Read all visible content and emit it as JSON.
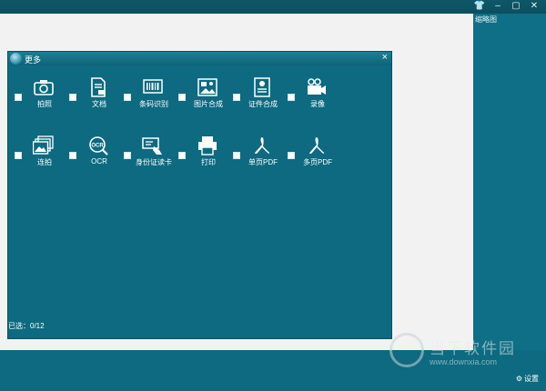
{
  "window": {
    "controls": {
      "skin": "👕",
      "minimize": "–",
      "maximize": "▢",
      "close": "✕"
    }
  },
  "right_panel": {
    "title": "缩略图"
  },
  "dialog": {
    "title": "更多",
    "close": "×",
    "selected_label": "已选：0/12",
    "tools": [
      {
        "label": "拍照",
        "icon": "camera-icon"
      },
      {
        "label": "文档",
        "icon": "document-icon"
      },
      {
        "label": "条码识别",
        "icon": "barcode-icon"
      },
      {
        "label": "图片合成",
        "icon": "image-merge-icon"
      },
      {
        "label": "证件合成",
        "icon": "id-merge-icon"
      },
      {
        "label": "录像",
        "icon": "video-icon"
      },
      {
        "label": "连拍",
        "icon": "burst-icon"
      },
      {
        "label": "OCR",
        "icon": "ocr-icon"
      },
      {
        "label": "身份证读卡",
        "icon": "id-card-reader-icon"
      },
      {
        "label": "打印",
        "icon": "printer-icon"
      },
      {
        "label": "单页PDF",
        "icon": "pdf-icon"
      },
      {
        "label": "多页PDF",
        "icon": "pdf-icon"
      }
    ]
  },
  "footer": {
    "settings_label": "设置",
    "settings_icon": "⚙"
  },
  "watermark": {
    "text": "当下软件园",
    "url": "www.downxia.com"
  },
  "colors": {
    "background": "#0d6a80",
    "preview": "#f2f2f2",
    "topbar": "#0b4f5f"
  }
}
